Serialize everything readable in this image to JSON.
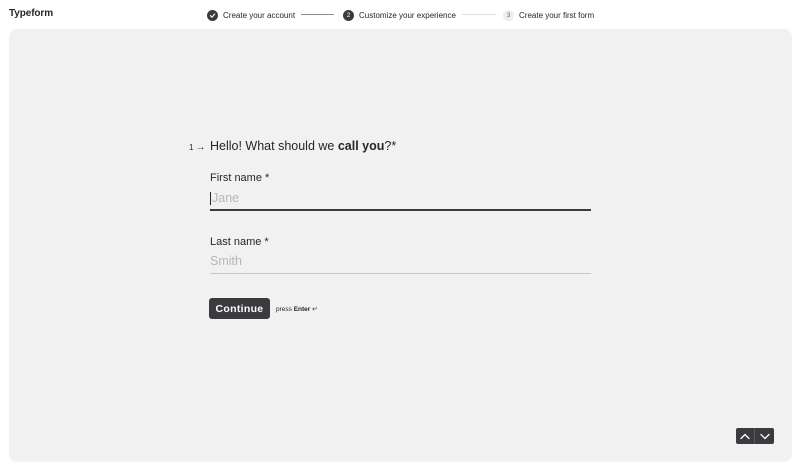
{
  "app": {
    "logo": "Typeform"
  },
  "steps": [
    {
      "number": "",
      "label": "Create your account",
      "state": "done"
    },
    {
      "number": "2",
      "label": "Customize your experience",
      "state": "active"
    },
    {
      "number": "3",
      "label": "Create your first form",
      "state": "todo"
    }
  ],
  "question": {
    "number": "1",
    "arrow": "→",
    "title_pre": "Hello! What should we ",
    "title_bold": "call you",
    "title_post": "?*"
  },
  "fields": {
    "first_name": {
      "label": "First name *",
      "placeholder": "Jane",
      "value": ""
    },
    "last_name": {
      "label": "Last name *",
      "placeholder": "Smith",
      "value": ""
    }
  },
  "actions": {
    "continue_label": "Continue",
    "hint_pre": "press ",
    "hint_key": "Enter",
    "hint_glyph": "↵"
  },
  "colors": {
    "accent": "#3b3a3e",
    "panel": "#f1f1f1"
  }
}
